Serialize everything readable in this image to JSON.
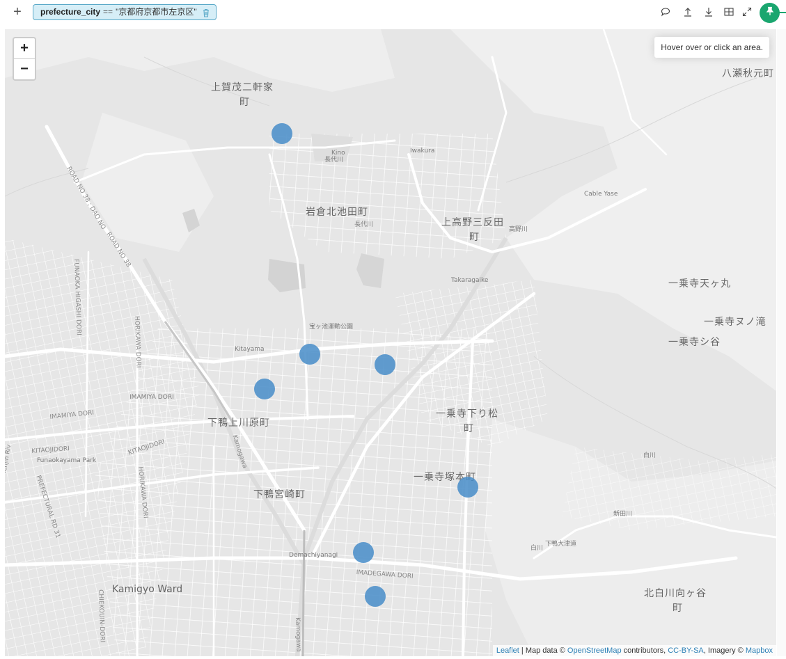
{
  "toolbar": {
    "add_label": "+",
    "filter": {
      "field": "prefecture_city",
      "operator": "==",
      "value": "\"京都府京都市左京区\""
    },
    "icons": [
      "comment-icon",
      "upload-icon",
      "download-icon",
      "table-icon",
      "expand-icon",
      "pin-icon"
    ],
    "accent_color": "#1aa66f"
  },
  "map": {
    "zoom_in_label": "+",
    "zoom_out_label": "−",
    "info_text": "Hover over or click an area.",
    "marker_color": "#468cc8",
    "places_large": [
      "上賀茂二軒家",
      "町",
      "岩倉北池田町",
      "上高野三反田",
      "町",
      "八瀬秋元町",
      "一乗寺天ヶ丸",
      "一乗寺ヌノ滝",
      "一乗寺シ谷",
      "一乗寺下り松",
      "町",
      "下鴨上川原町",
      "一乗寺塚本町",
      "下鴨宮崎町",
      "北白川向ヶ谷",
      "町",
      "Kamigyo Ward"
    ],
    "places_small": [
      "Kino",
      "長代川",
      "Iwakura",
      "長代川",
      "Cable Yase",
      "高野川",
      "Takaragaike",
      "宝ヶ池運動公園",
      "Kitayama",
      "IMAMIYA DORI",
      "IMAMIYA DORI",
      "KITAOJIDORI",
      "Funaokayama Park",
      "KITAOJIDORI",
      "Demachiyanagi",
      "IMADEGAWA DORI",
      "白川",
      "Kamogawa",
      "Kamogawa",
      "Tenjin Riv",
      "PREFECTURAL RD 31",
      "FUNAOKA HIGASHI DORI",
      "HORIKAWA DORI",
      "HORIKAWA DORI",
      "CHIEKOUIN-DORI",
      "ROAD NO 38 ; DAO NO",
      "ROAD NO 38",
      "新田川",
      "下鴨大津道",
      "白川"
    ],
    "attribution": {
      "leaflet": "Leaflet",
      "sep1": " | Map data © ",
      "osm": "OpenStreetMap",
      "contributors": " contributors, ",
      "license": "CC-BY-SA",
      "imagery": ", Imagery © ",
      "mapbox": "Mapbox"
    }
  }
}
